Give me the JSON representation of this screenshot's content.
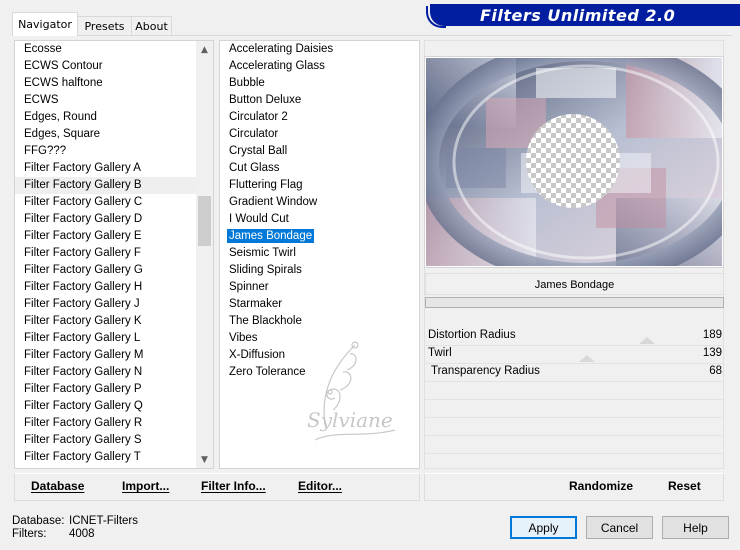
{
  "tabs": [
    {
      "label": "Navigator",
      "active": true
    },
    {
      "label": "Presets",
      "active": false
    },
    {
      "label": "About",
      "active": false
    }
  ],
  "banner": {
    "title": "Filters Unlimited 2.0"
  },
  "categories": [
    "Ecosse",
    "ECWS Contour",
    "ECWS halftone",
    "ECWS",
    "Edges, Round",
    "Edges, Square",
    "FFG???",
    "Filter Factory Gallery A",
    "Filter Factory Gallery B",
    "Filter Factory Gallery C",
    "Filter Factory Gallery D",
    "Filter Factory Gallery E",
    "Filter Factory Gallery F",
    "Filter Factory Gallery G",
    "Filter Factory Gallery H",
    "Filter Factory Gallery J",
    "Filter Factory Gallery K",
    "Filter Factory Gallery L",
    "Filter Factory Gallery M",
    "Filter Factory Gallery N",
    "Filter Factory Gallery P",
    "Filter Factory Gallery Q",
    "Filter Factory Gallery R",
    "Filter Factory Gallery S",
    "Filter Factory Gallery T"
  ],
  "selected_category": "Filter Factory Gallery B",
  "filters": [
    "Accelerating Daisies",
    "Accelerating Glass",
    "Bubble",
    "Button Deluxe",
    "Circulator 2",
    "Circulator",
    "Crystal Ball",
    "Cut Glass",
    "Fluttering Flag",
    "Gradient Window",
    "I Would Cut",
    "James Bondage",
    "Seismic Twirl",
    "Sliding Spirals",
    "Spinner",
    "Starmaker",
    "The Blackhole",
    "Vibes",
    "X-Diffusion",
    "Zero Tolerance"
  ],
  "selected_filter": "James Bondage",
  "left_commands": {
    "database": "Database",
    "import": "Import...",
    "filter_info": "Filter Info...",
    "editor": "Editor..."
  },
  "right_commands": {
    "randomize": "Randomize",
    "reset": "Reset"
  },
  "params": {
    "title": "James Bondage",
    "items": [
      {
        "label": "Distortion Radius",
        "value": "189"
      },
      {
        "label": "Twirl",
        "value": "139"
      },
      {
        "label": "Transparency Radius",
        "value": "68"
      }
    ]
  },
  "footer": {
    "database_label": "Database:",
    "database_value": "ICNET-Filters",
    "filters_label": "Filters:",
    "filters_value": "4008"
  },
  "buttons": {
    "apply": "Apply",
    "cancel": "Cancel",
    "help": "Help"
  },
  "watermark": {
    "text": "Sylviane"
  },
  "colors": {
    "banner": "#001e9f",
    "selection": "#0078d7"
  }
}
